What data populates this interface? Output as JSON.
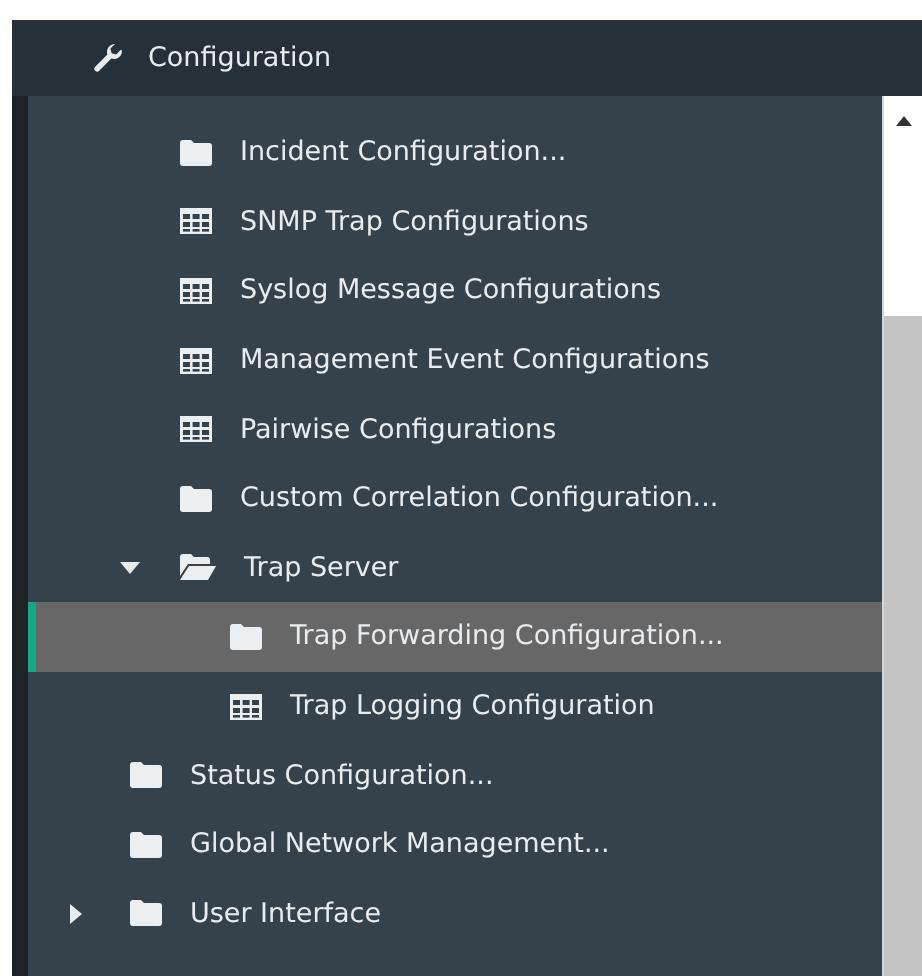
{
  "header": {
    "title": "Configuration"
  },
  "tree": {
    "items": [
      {
        "children": [
          {
            "label": "Incident Configuration...",
            "kind": "folder"
          },
          {
            "label": "SNMP Trap Configurations",
            "kind": "table"
          },
          {
            "label": "Syslog Message Configurations",
            "kind": "table"
          },
          {
            "label": "Management Event Configurations",
            "kind": "table"
          },
          {
            "label": "Pairwise Configurations",
            "kind": "table"
          },
          {
            "label": "Custom Correlation Configuration...",
            "kind": "folder"
          },
          {
            "label": "Trap Server",
            "kind": "folder-open",
            "expanded": true,
            "children": [
              {
                "label": "Trap Forwarding Configuration...",
                "kind": "folder",
                "selected": true
              },
              {
                "label": "Trap Logging Configuration",
                "kind": "table",
                "selected": false
              }
            ]
          }
        ]
      },
      {
        "label": "Status Configuration...",
        "kind": "folder"
      },
      {
        "label": "Global Network Management...",
        "kind": "folder"
      },
      {
        "label": "User Interface",
        "kind": "folder",
        "expanded": false
      }
    ]
  }
}
